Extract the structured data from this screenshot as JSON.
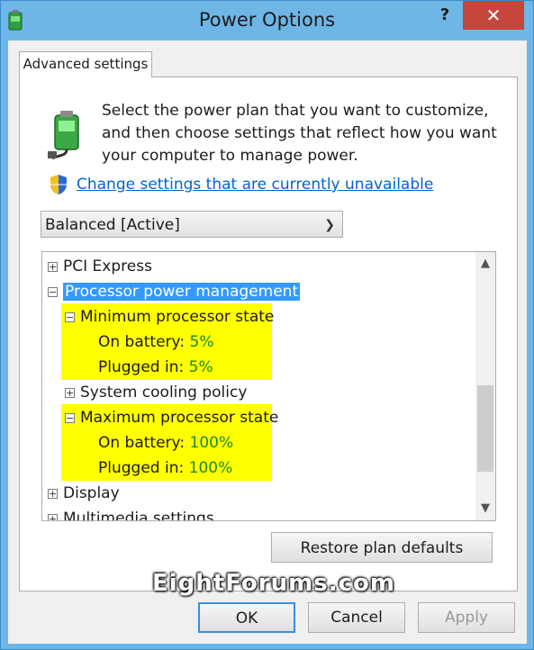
{
  "window": {
    "title": "Power Options",
    "help": "?",
    "close": "✕"
  },
  "tab": {
    "label": "Advanced settings"
  },
  "description": "Select the power plan that you want to customize, and then choose settings that reflect how you want your computer to manage power.",
  "change_link": "Change settings that are currently unavailable",
  "plan_select": {
    "value": "Balanced [Active]"
  },
  "tree": {
    "pci_express": "PCI Express",
    "processor_pm": "Processor power management",
    "min_state": {
      "label": "Minimum processor state",
      "on_battery_label": "On battery:",
      "on_battery_value": "5%",
      "plugged_in_label": "Plugged in:",
      "plugged_in_value": "5%"
    },
    "cooling": "System cooling policy",
    "max_state": {
      "label": "Maximum processor state",
      "on_battery_label": "On battery:",
      "on_battery_value": "100%",
      "plugged_in_label": "Plugged in:",
      "plugged_in_value": "100%"
    },
    "display": "Display",
    "multimedia": "Multimedia settings"
  },
  "restore_button": "Restore plan defaults",
  "watermark": "EightForums.com",
  "buttons": {
    "ok": "OK",
    "cancel": "Cancel",
    "apply": "Apply"
  },
  "colors": {
    "highlight": "#ffff00",
    "selection": "#3399ff",
    "value": "#1a8a1a",
    "close": "#c7463b",
    "link": "#0066cc"
  },
  "icons": [
    "battery-plug-icon",
    "uac-shield-icon",
    "expand-icon",
    "collapse-icon",
    "chevron-down-icon",
    "scroll-up-icon",
    "scroll-down-icon"
  ]
}
